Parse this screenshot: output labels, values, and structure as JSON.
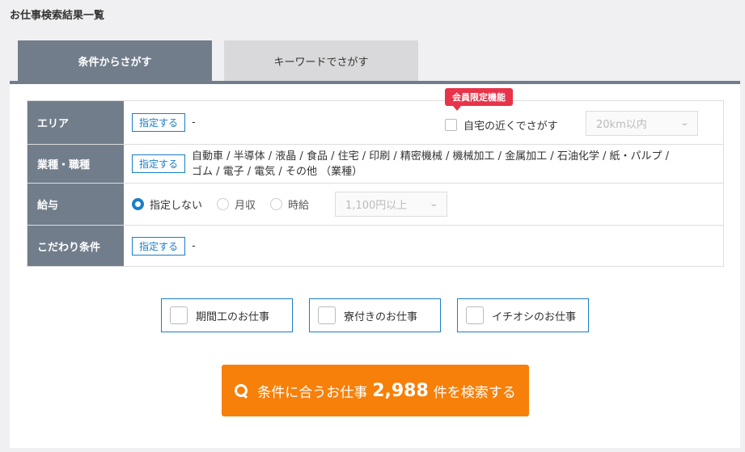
{
  "page": {
    "title": "お仕事検索結果一覧"
  },
  "tabs": {
    "conditions": "条件からさがす",
    "keyword": "キーワードでさがす"
  },
  "area": {
    "label": "エリア",
    "button": "指定する",
    "value": "-",
    "members_badge": "会員限定機能",
    "near_label": "自宅の近くでさがす",
    "distance_select": "20km以内"
  },
  "industry": {
    "label": "業種・職種",
    "button": "指定する",
    "value_line1": "自動車 / 半導体 / 液晶 / 食品 / 住宅 / 印刷 / 精密機械 / 機械加工 / 金属加工 / 石油化学 / 紙・パルプ /",
    "value_line2": "ゴム / 電子 / 電気 / その他 （業種）"
  },
  "salary": {
    "label": "給与",
    "option_none": "指定しない",
    "option_monthly": "月収",
    "option_hourly": "時給",
    "selected": "指定しない",
    "amount_select": "1,100円以上"
  },
  "special": {
    "label": "こだわり条件",
    "button": "指定する",
    "value": "-"
  },
  "options": [
    {
      "label": "期間工のお仕事",
      "checked": false
    },
    {
      "label": "寮付きのお仕事",
      "checked": false
    },
    {
      "label": "イチオシのお仕事",
      "checked": false
    }
  ],
  "search": {
    "prefix": "条件に合うお仕事",
    "count": "2,988",
    "suffix": "件を検索する"
  },
  "colors": {
    "accent": "#1a7ec8",
    "tab": "#727d8b",
    "badge": "#e8334a",
    "search": "#f7800a"
  }
}
